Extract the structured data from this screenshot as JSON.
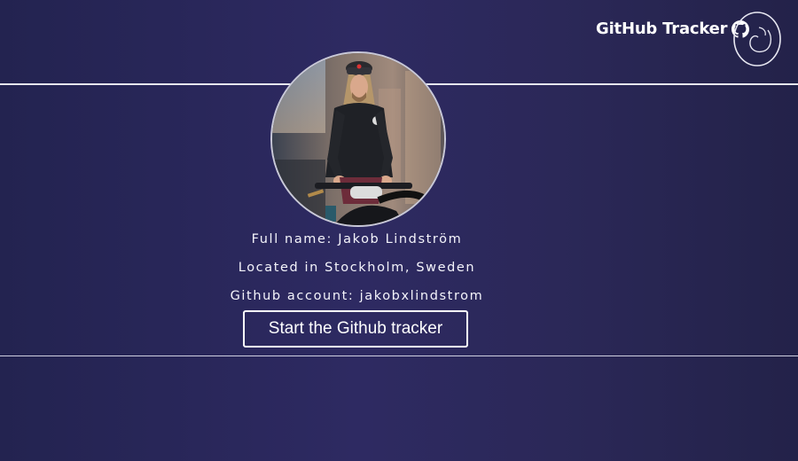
{
  "header": {
    "title": "GitHub Tracker",
    "icon": "github-octocat-icon",
    "logo": "ring-logo-icon"
  },
  "profile": {
    "avatar": "profile-avatar-photo",
    "full_name_line": "Full name: Jakob Lindström",
    "location_line": "Located in Stockholm, Sweden",
    "account_line": "Github account: jakobxlindstrom"
  },
  "actions": {
    "start_label": "Start the Github tracker"
  },
  "colors": {
    "background": "#2b2858",
    "text": "#ffffff",
    "divider": "#e6e6ee"
  }
}
